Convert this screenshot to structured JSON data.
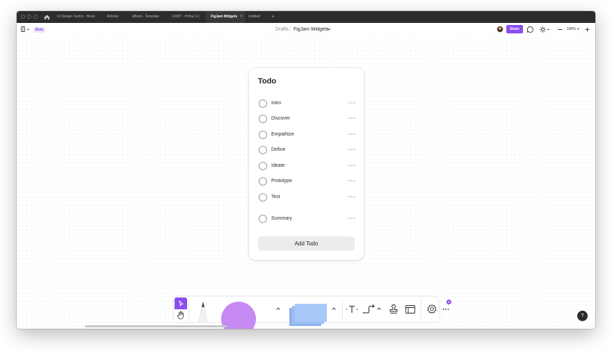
{
  "tabs": [
    {
      "label": "UI Design Tactics - Book"
    },
    {
      "label": "Articles"
    },
    {
      "label": "eBook - Template"
    },
    {
      "label": "UXMT - Prime 3.1"
    },
    {
      "label": "FigJam Widgets",
      "active": true
    },
    {
      "label": "Untitled"
    }
  ],
  "tab_close": "×",
  "tab_add": "+",
  "toolbar": {
    "badge": "Beta",
    "breadcrumb_root": "Drafts",
    "breadcrumb_sep": "/",
    "file_name": "FigJam Widgets",
    "share_label": "Share",
    "zoom": "100%"
  },
  "widget": {
    "title": "Todo",
    "items": [
      {
        "label": "Intro"
      },
      {
        "label": "Discover"
      },
      {
        "label": "Empathize"
      },
      {
        "label": "Define"
      },
      {
        "label": "Ideate"
      },
      {
        "label": "Prototype"
      },
      {
        "label": "Test"
      },
      {
        "label": "Summary"
      }
    ],
    "add_label": "Add Todo"
  },
  "dock": {
    "badge_count": "2"
  },
  "help_label": "?",
  "colors": {
    "accent": "#8b4eee",
    "titlebar": "#2c2c2c",
    "circle": "#c68af2",
    "sticky": "#a8c8f8"
  }
}
